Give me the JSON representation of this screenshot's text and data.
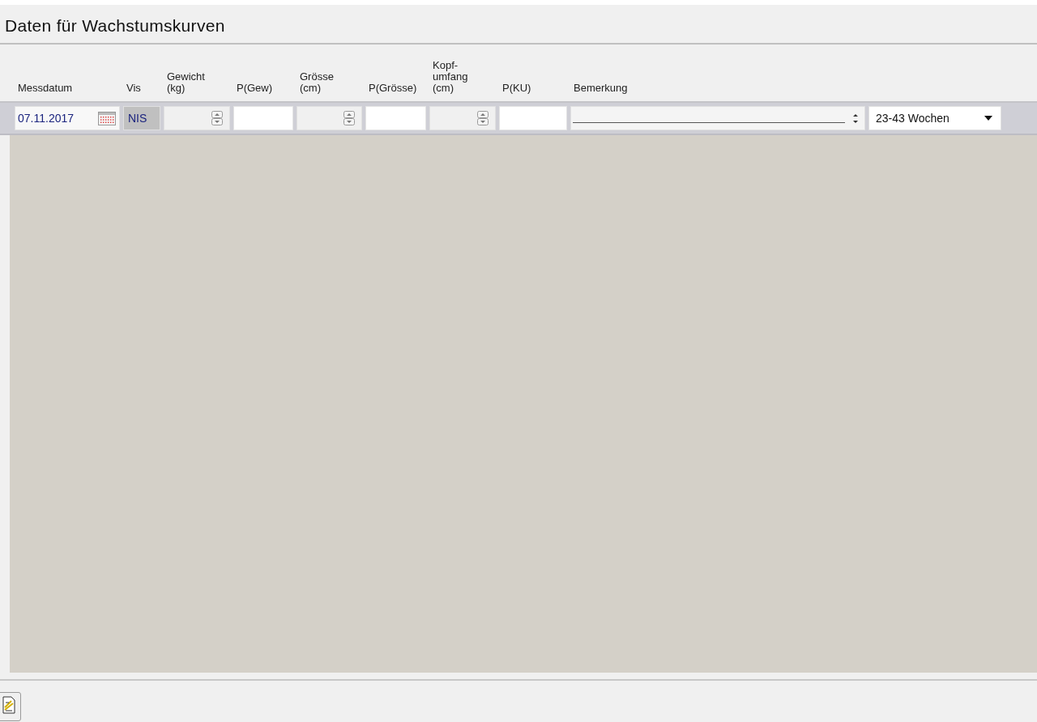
{
  "title": "Daten für Wachstumskurven",
  "columns": [
    "Messdatum",
    "Vis",
    "Gewicht\n(kg)",
    "P(Gew)",
    "Grösse\n(cm)",
    "P(Grösse)",
    "Kopf-\numfang\n(cm)",
    "P(KU)",
    "Bemerkung"
  ],
  "row": [
    {
      "kind": "date",
      "value": "07.11.2017"
    },
    {
      "kind": "code",
      "value": "NIS"
    },
    {
      "kind": "spin",
      "disabled": true
    },
    {
      "kind": "field",
      "disabled": false
    },
    {
      "kind": "spin",
      "disabled": true
    },
    {
      "kind": "field",
      "disabled": false
    },
    {
      "kind": "spin",
      "disabled": true
    },
    {
      "kind": "field",
      "disabled": false
    },
    {
      "kind": "memo"
    },
    {
      "kind": "dropdown",
      "value": "23-43 Wochen"
    }
  ]
}
